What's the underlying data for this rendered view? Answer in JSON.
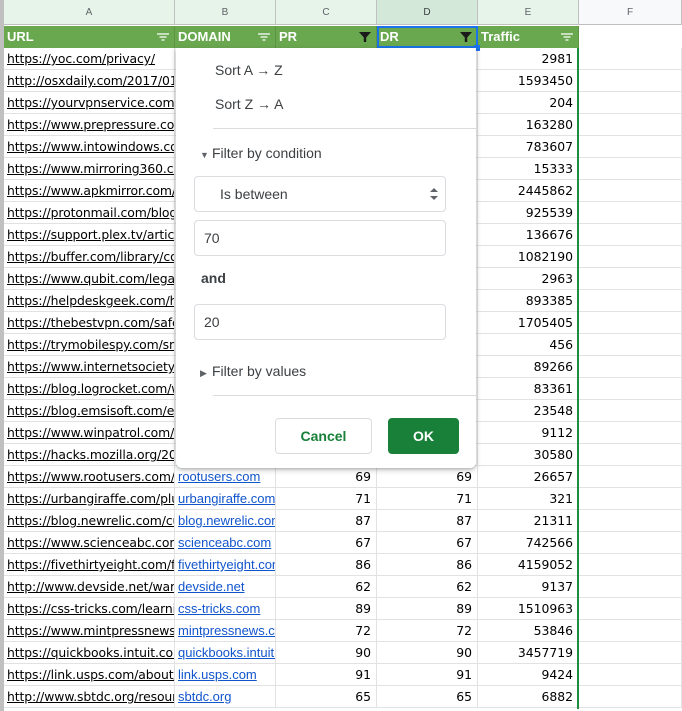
{
  "column_letters": [
    "A",
    "B",
    "C",
    "D",
    "E",
    "F"
  ],
  "header": {
    "columns": [
      {
        "label": "URL",
        "filter": "filter-lines-icon"
      },
      {
        "label": "DOMAIN",
        "filter": "filter-lines-icon"
      },
      {
        "label": "PR",
        "filter": "filter-funnel-icon"
      },
      {
        "label": "DR",
        "filter": "filter-funnel-icon"
      },
      {
        "label": "Traffic",
        "filter": "filter-lines-icon"
      }
    ]
  },
  "colors": {
    "header_green": "#6aa84f",
    "ok_green": "#188038",
    "link_blue": "#1155cc",
    "selection_blue": "#1a73e8"
  },
  "rows": [
    {
      "url": "https://yoc.com/privacy/",
      "domain": "",
      "pr": "",
      "dr": "",
      "traffic": "2981"
    },
    {
      "url": "http://osxdaily.com/2017/01",
      "domain": "",
      "pr": "",
      "dr": "",
      "traffic": "1593450"
    },
    {
      "url": "https://yourvpnservice.com/",
      "domain": "",
      "pr": "",
      "dr": "",
      "traffic": "204"
    },
    {
      "url": "https://www.prepressure.com",
      "domain": "",
      "pr": "",
      "dr": "",
      "traffic": "163280"
    },
    {
      "url": "https://www.intowindows.co",
      "domain": "",
      "pr": "",
      "dr": "",
      "traffic": "783607"
    },
    {
      "url": "https://www.mirroring360.co",
      "domain": "",
      "pr": "",
      "dr": "",
      "traffic": "15333"
    },
    {
      "url": "https://www.apkmirror.com/",
      "domain": "",
      "pr": "",
      "dr": "",
      "traffic": "2445862"
    },
    {
      "url": "https://protonmail.com/blog",
      "domain": "",
      "pr": "",
      "dr": "",
      "traffic": "925539"
    },
    {
      "url": "https://support.plex.tv/articl",
      "domain": "",
      "pr": "",
      "dr": "",
      "traffic": "136676"
    },
    {
      "url": "https://buffer.com/library/co",
      "domain": "",
      "pr": "",
      "dr": "",
      "traffic": "1082190"
    },
    {
      "url": "https://www.qubit.com/lega",
      "domain": "",
      "pr": "",
      "dr": "",
      "traffic": "2963"
    },
    {
      "url": "https://helpdeskgeek.com/h",
      "domain": "",
      "pr": "",
      "dr": "",
      "traffic": "893385"
    },
    {
      "url": "https://thebestvpn.com/safe",
      "domain": "",
      "pr": "",
      "dr": "",
      "traffic": "1705405"
    },
    {
      "url": "https://trymobilespy.com/sm",
      "domain": "",
      "pr": "",
      "dr": "",
      "traffic": "456"
    },
    {
      "url": "https://www.internetsociety.",
      "domain": "",
      "pr": "",
      "dr": "",
      "traffic": "89266"
    },
    {
      "url": "https://blog.logrocket.com/w",
      "domain": "",
      "pr": "",
      "dr": "",
      "traffic": "83361"
    },
    {
      "url": "https://blog.emsisoft.com/er",
      "domain": "",
      "pr": "",
      "dr": "",
      "traffic": "23548"
    },
    {
      "url": "https://www.winpatrol.com/",
      "domain": "",
      "pr": "",
      "dr": "",
      "traffic": "9112"
    },
    {
      "url": "https://hacks.mozilla.org/201",
      "domain": "",
      "pr": "",
      "dr": "",
      "traffic": "30580"
    },
    {
      "url": "https://www.rootusers.com/",
      "domain": "rootusers.com",
      "pr": "69",
      "dr": "69",
      "traffic": "26657"
    },
    {
      "url": "https://urbangiraffe.com/plu",
      "domain": "urbangiraffe.com",
      "pr": "71",
      "dr": "71",
      "traffic": "321"
    },
    {
      "url": "https://blog.newrelic.com/cu",
      "domain": "blog.newrelic.com",
      "pr": "87",
      "dr": "87",
      "traffic": "21311"
    },
    {
      "url": "https://www.scienceabc.com",
      "domain": "scienceabc.com",
      "pr": "67",
      "dr": "67",
      "traffic": "742566"
    },
    {
      "url": "https://fivethirtyeight.com/fe",
      "domain": "fivethirtyeight.com",
      "pr": "86",
      "dr": "86",
      "traffic": "4159052"
    },
    {
      "url": "http://www.devside.net/war",
      "domain": "devside.net",
      "pr": "62",
      "dr": "62",
      "traffic": "9137"
    },
    {
      "url": "https://css-tricks.com/learnin",
      "domain": "css-tricks.com",
      "pr": "89",
      "dr": "89",
      "traffic": "1510963"
    },
    {
      "url": "https://www.mintpressnews.",
      "domain": "mintpressnews.com",
      "pr": "72",
      "dr": "72",
      "traffic": "53846"
    },
    {
      "url": "https://quickbooks.intuit.com",
      "domain": "quickbooks.intuit.com",
      "pr": "90",
      "dr": "90",
      "traffic": "3457719"
    },
    {
      "url": "https://link.usps.com/about/",
      "domain": "link.usps.com",
      "pr": "91",
      "dr": "91",
      "traffic": "9424"
    },
    {
      "url": "http://www.sbtdc.org/resour",
      "domain": "sbtdc.org",
      "pr": "65",
      "dr": "65",
      "traffic": "6882"
    }
  ],
  "filter_menu": {
    "sort_az": "Sort A → Z",
    "sort_za": "Sort Z → A",
    "filter_by_condition": "Filter by condition",
    "condition_selected": "Is between",
    "value1": "70",
    "and_label": "and",
    "value2": "20",
    "filter_by_values": "Filter by values",
    "cancel": "Cancel",
    "ok": "OK"
  }
}
